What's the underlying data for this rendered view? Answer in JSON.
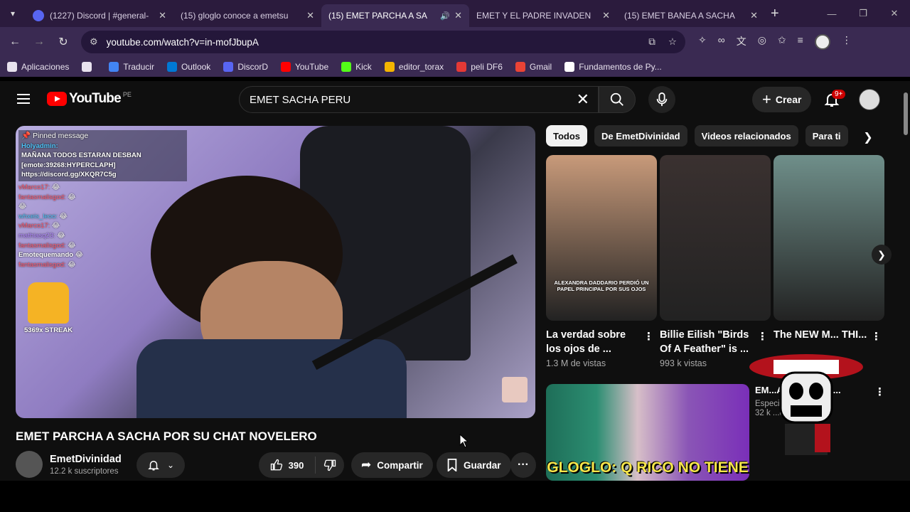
{
  "browser": {
    "tabs": [
      {
        "title": "(1227) Discord | #general-",
        "favicon": "discord",
        "active": false
      },
      {
        "title": "(15) gloglo conoce a emetsu",
        "favicon": "youtube",
        "active": false
      },
      {
        "title": "(15) EMET PARCHA A SA",
        "favicon": "youtube",
        "active": true
      },
      {
        "title": "EMET Y EL PADRE INVADEN",
        "favicon": "youtube",
        "active": false
      },
      {
        "title": "(15) EMET BANEA A SACHA",
        "favicon": "youtube",
        "active": false
      }
    ],
    "url": "youtube.com/watch?v=in-mofJbupA",
    "bookmarks": [
      {
        "label": "Aplicaciones",
        "color": "#e8e2ee"
      },
      {
        "label": "",
        "color": "#e8e2ee"
      },
      {
        "label": "Traducir",
        "color": "#4285f4"
      },
      {
        "label": "Outlook",
        "color": "#0078d4"
      },
      {
        "label": "DiscorD",
        "color": "#5865f2"
      },
      {
        "label": "YouTube",
        "color": "#ff0000"
      },
      {
        "label": "Kick",
        "color": "#53fc18"
      },
      {
        "label": "editor_torax",
        "color": "#f4b400"
      },
      {
        "label": "peli DF6",
        "color": "#e53935"
      },
      {
        "label": "Gmail",
        "color": "#ea4335"
      },
      {
        "label": "Fundamentos de Py...",
        "color": "#ffffff"
      }
    ]
  },
  "youtube": {
    "logo_text": "YouTube",
    "country": "PE",
    "search_query": "EMET SACHA PERU",
    "create_label": "Crear",
    "notif_badge": "9+",
    "video": {
      "title": "EMET PARCHA A SACHA POR SU CHAT NOVELERO",
      "channel": "EmetDivinidad",
      "subscribers": "12.2 k suscriptores",
      "likes": "390",
      "share_label": "Compartir",
      "save_label": "Guardar"
    },
    "overlay": {
      "pinned_header": "Pinned message",
      "pinned_user": "Holyadmin:",
      "pinned_lines": [
        "MAÑANA TODOS ESTARAN DESBAN",
        "[emote:39268:HYPERCLAPH]",
        "https://discord.gg/XKQR7C5g"
      ],
      "chat": [
        {
          "user": "vMarco17:",
          "msg": "",
          "cls": "u1"
        },
        {
          "user": "fantasmalisgod:",
          "msg": "",
          "cls": "u1"
        },
        {
          "user": "",
          "msg": "",
          "cls": "u2"
        },
        {
          "user": "whxeis_leoo:",
          "msg": "",
          "cls": "u2"
        },
        {
          "user": "vMarco17:",
          "msg": "",
          "cls": "u1"
        },
        {
          "user": "mathiasq23:",
          "msg": "",
          "cls": "u3"
        },
        {
          "user": "fantasmalisgod:",
          "msg": "",
          "cls": "u1"
        },
        {
          "user": "",
          "msg": "Emotequemando",
          "cls": "u2"
        },
        {
          "user": "fantasmalisgod:",
          "msg": "",
          "cls": "u1"
        }
      ],
      "streak": "5369x STREAK"
    },
    "chips": [
      {
        "label": "Todos",
        "active": true
      },
      {
        "label": "De EmetDivinidad",
        "active": false
      },
      {
        "label": "Videos relacionados",
        "active": false
      },
      {
        "label": "Para ti",
        "active": false
      }
    ],
    "shorts": [
      {
        "title": "La verdad sobre los ojos de ...",
        "views": "1.3 M de vistas",
        "caption": "ALEXANDRA DADDARIO PERDIÓ UN PAPEL PRINCIPAL POR SUS OJOS",
        "bg": "#c89a7a"
      },
      {
        "title": "Billie Eilish \"Birds Of A Feather\" is ...",
        "views": "993 k vistas",
        "caption": "",
        "bg": "#3a3130"
      },
      {
        "title": "The NEW M... THI...",
        "views": "",
        "caption": "",
        "bg": "#6f8f8a"
      }
    ],
    "rec": {
      "thumb_caption": "GLOGLO: Q RICO NO TIENE",
      "title": "EM...A A TIK...ON ...",
      "meta1": "Especia...",
      "meta2": "32 k ...es"
    }
  }
}
